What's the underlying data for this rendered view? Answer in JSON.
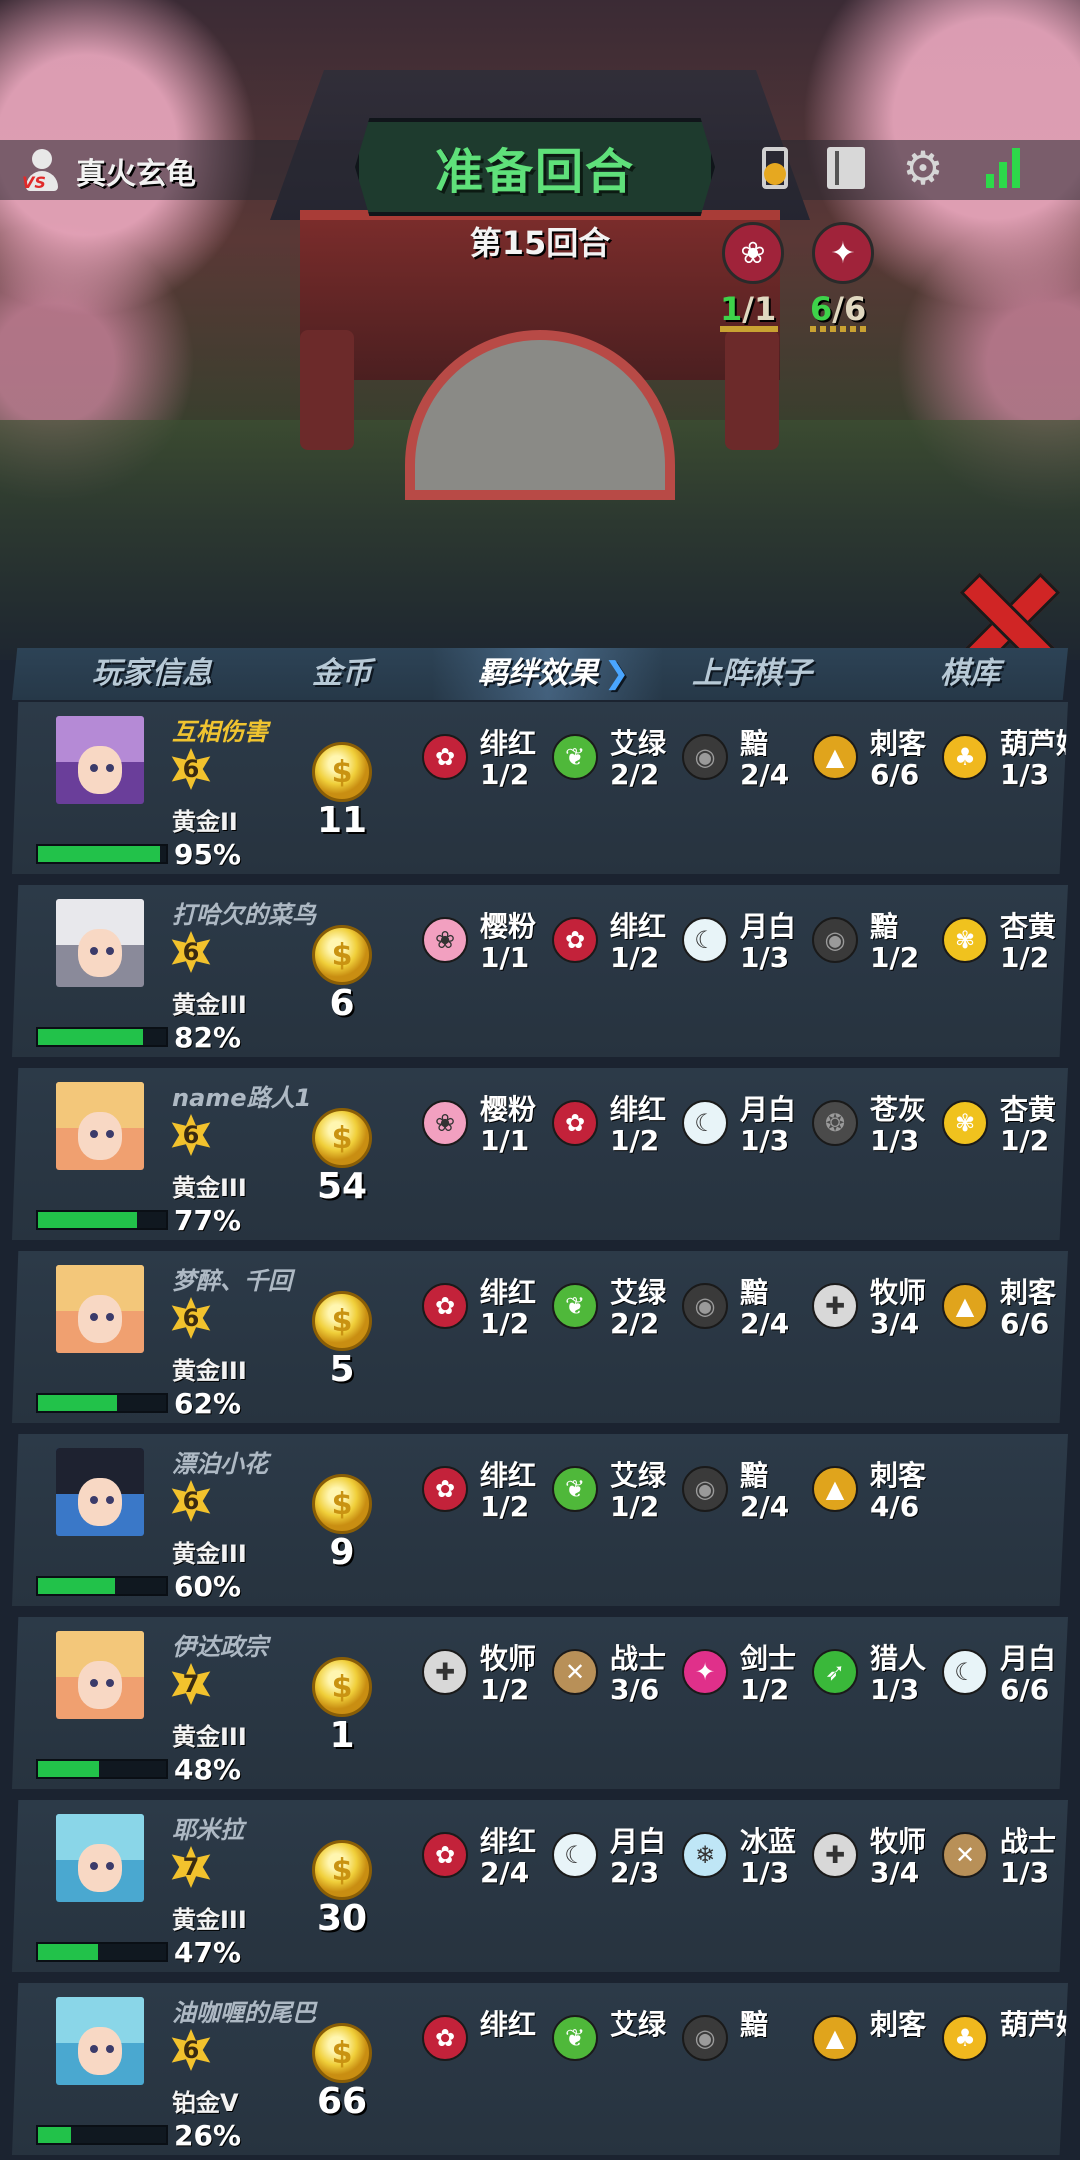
{
  "header": {
    "player_name": "真火玄龟",
    "phase": "准备回合",
    "round": "第15回合",
    "synergy_counts": [
      {
        "active": "1",
        "sep": "/",
        "total": "1",
        "color": "#a0233a",
        "icon": "sakura-icon"
      },
      {
        "active": "6",
        "sep": "/",
        "total": "6",
        "color": "#a0233a",
        "icon": "blade-icon"
      }
    ]
  },
  "tabs": {
    "player_info": "玩家信息",
    "gold": "金币",
    "bonds": "羁绊效果",
    "deployed": "上阵棋子",
    "library": "棋库"
  },
  "players": [
    {
      "name": "互相伤害",
      "level": "6",
      "rank": "黄金II",
      "hp": "95%",
      "hp_value": 0.95,
      "gold": "11",
      "is_self": true,
      "avatar_hair": "#b58ad6",
      "avatar_bg": "#6a3e9a",
      "bonds": [
        {
          "name": "绯红",
          "count": "1/2",
          "icon": "rose-icon",
          "bg": "#c3223a",
          "glyph": "✿"
        },
        {
          "name": "艾绿",
          "count": "2/2",
          "icon": "leaf-icon",
          "bg": "#4fb83a",
          "glyph": "❦"
        },
        {
          "name": "黯",
          "count": "2/4",
          "icon": "dark-eye-icon",
          "bg": "#3a3a3a",
          "glyph": "◉"
        },
        {
          "name": "刺客",
          "count": "6/6",
          "icon": "assassin-icon",
          "bg": "#e0a41c",
          "glyph": "▲"
        },
        {
          "name": "葫芦娃",
          "count": "1/3",
          "icon": "gourd-icon",
          "bg": "#f0b81e",
          "glyph": "♣"
        }
      ]
    },
    {
      "name": "打哈欠的菜鸟",
      "level": "6",
      "rank": "黄金III",
      "hp": "82%",
      "hp_value": 0.82,
      "gold": "6",
      "is_self": false,
      "avatar_hair": "#e8e8ec",
      "avatar_bg": "#8a8a9a",
      "bonds": [
        {
          "name": "樱粉",
          "count": "1/1",
          "icon": "sakura-icon",
          "bg": "#f2a0c0",
          "glyph": "❀"
        },
        {
          "name": "绯红",
          "count": "1/2",
          "icon": "rose-icon",
          "bg": "#c3223a",
          "glyph": "✿"
        },
        {
          "name": "月白",
          "count": "1/3",
          "icon": "moon-icon",
          "bg": "#e8f4f8",
          "glyph": "☾"
        },
        {
          "name": "黯",
          "count": "1/2",
          "icon": "dark-eye-icon",
          "bg": "#3a3a3a",
          "glyph": "◉"
        },
        {
          "name": "杏黄",
          "count": "1/2",
          "icon": "lotus-icon",
          "bg": "#f0c21e",
          "glyph": "✾"
        }
      ]
    },
    {
      "name": "name路人1",
      "level": "6",
      "rank": "黄金III",
      "hp": "77%",
      "hp_value": 0.77,
      "gold": "54",
      "is_self": false,
      "avatar_hair": "#f3c77a",
      "avatar_bg": "#f0a070",
      "bonds": [
        {
          "name": "樱粉",
          "count": "1/1",
          "icon": "sakura-icon",
          "bg": "#f2a0c0",
          "glyph": "❀"
        },
        {
          "name": "绯红",
          "count": "1/2",
          "icon": "rose-icon",
          "bg": "#c3223a",
          "glyph": "✿"
        },
        {
          "name": "月白",
          "count": "1/3",
          "icon": "moon-icon",
          "bg": "#e8f4f8",
          "glyph": "☾"
        },
        {
          "name": "苍灰",
          "count": "1/3",
          "icon": "grey-orb-icon",
          "bg": "#4a4a4a",
          "glyph": "❂"
        },
        {
          "name": "杏黄",
          "count": "1/2",
          "icon": "lotus-icon",
          "bg": "#f0c21e",
          "glyph": "✾"
        }
      ]
    },
    {
      "name": "梦醉、千回",
      "level": "6",
      "rank": "黄金III",
      "hp": "62%",
      "hp_value": 0.62,
      "gold": "5",
      "is_self": false,
      "avatar_hair": "#f3c77a",
      "avatar_bg": "#f0a070",
      "bonds": [
        {
          "name": "绯红",
          "count": "1/2",
          "icon": "rose-icon",
          "bg": "#c3223a",
          "glyph": "✿"
        },
        {
          "name": "艾绿",
          "count": "2/2",
          "icon": "leaf-icon",
          "bg": "#4fb83a",
          "glyph": "❦"
        },
        {
          "name": "黯",
          "count": "2/4",
          "icon": "dark-eye-icon",
          "bg": "#3a3a3a",
          "glyph": "◉"
        },
        {
          "name": "牧师",
          "count": "3/4",
          "icon": "priest-icon",
          "bg": "#d8d8d8",
          "glyph": "✚"
        },
        {
          "name": "刺客",
          "count": "6/6",
          "icon": "assassin-icon",
          "bg": "#e0a41c",
          "glyph": "▲"
        }
      ]
    },
    {
      "name": "漂泊小花",
      "level": "6",
      "rank": "黄金III",
      "hp": "60%",
      "hp_value": 0.6,
      "gold": "9",
      "is_self": false,
      "avatar_hair": "#1e2230",
      "avatar_bg": "#3a78c8",
      "bonds": [
        {
          "name": "绯红",
          "count": "1/2",
          "icon": "rose-icon",
          "bg": "#c3223a",
          "glyph": "✿"
        },
        {
          "name": "艾绿",
          "count": "1/2",
          "icon": "leaf-icon",
          "bg": "#4fb83a",
          "glyph": "❦"
        },
        {
          "name": "黯",
          "count": "2/4",
          "icon": "dark-eye-icon",
          "bg": "#3a3a3a",
          "glyph": "◉"
        },
        {
          "name": "刺客",
          "count": "4/6",
          "icon": "assassin-icon",
          "bg": "#e0a41c",
          "glyph": "▲"
        }
      ]
    },
    {
      "name": "伊达政宗",
      "level": "7",
      "rank": "黄金III",
      "hp": "48%",
      "hp_value": 0.48,
      "gold": "1",
      "is_self": false,
      "avatar_hair": "#f3c77a",
      "avatar_bg": "#f0a070",
      "bonds": [
        {
          "name": "牧师",
          "count": "1/2",
          "icon": "priest-icon",
          "bg": "#d8d8d8",
          "glyph": "✚"
        },
        {
          "name": "战士",
          "count": "3/6",
          "icon": "warrior-icon",
          "bg": "#b89058",
          "glyph": "✕"
        },
        {
          "name": "剑士",
          "count": "1/2",
          "icon": "swordsman-icon",
          "bg": "#e0308a",
          "glyph": "✦"
        },
        {
          "name": "猎人",
          "count": "1/3",
          "icon": "hunter-icon",
          "bg": "#3ab83a",
          "glyph": "➶"
        },
        {
          "name": "月白",
          "count": "6/6",
          "icon": "moon-icon",
          "bg": "#e8f4f8",
          "glyph": "☾"
        }
      ]
    },
    {
      "name": "耶米拉",
      "level": "7",
      "rank": "黄金III",
      "hp": "47%",
      "hp_value": 0.47,
      "gold": "30",
      "is_self": false,
      "avatar_hair": "#8ad6e8",
      "avatar_bg": "#4aa8d0",
      "bonds": [
        {
          "name": "绯红",
          "count": "2/4",
          "icon": "rose-icon",
          "bg": "#c3223a",
          "glyph": "✿"
        },
        {
          "name": "月白",
          "count": "2/3",
          "icon": "moon-icon",
          "bg": "#e8f4f8",
          "glyph": "☾"
        },
        {
          "name": "冰蓝",
          "count": "1/3",
          "icon": "snowflake-icon",
          "bg": "#bfe6f6",
          "glyph": "❄"
        },
        {
          "name": "牧师",
          "count": "3/4",
          "icon": "priest-icon",
          "bg": "#d8d8d8",
          "glyph": "✚"
        },
        {
          "name": "战士",
          "count": "1/3",
          "icon": "warrior-icon",
          "bg": "#b89058",
          "glyph": "✕"
        }
      ]
    },
    {
      "name": "油咖喱的尾巴",
      "level": "6",
      "rank": "铂金V",
      "hp": "26%",
      "hp_value": 0.26,
      "gold": "66",
      "is_self": false,
      "avatar_hair": "#8ad6e8",
      "avatar_bg": "#4aa8d0",
      "bonds": [
        {
          "name": "绯红",
          "count": "",
          "icon": "rose-icon",
          "bg": "#c3223a",
          "glyph": "✿"
        },
        {
          "name": "艾绿",
          "count": "",
          "icon": "leaf-icon",
          "bg": "#4fb83a",
          "glyph": "❦"
        },
        {
          "name": "黯",
          "count": "",
          "icon": "dark-eye-icon",
          "bg": "#3a3a3a",
          "glyph": "◉"
        },
        {
          "name": "刺客",
          "count": "",
          "icon": "assassin-icon",
          "bg": "#e0a41c",
          "glyph": "▲"
        },
        {
          "name": "葫芦娃",
          "count": "",
          "icon": "gourd-icon",
          "bg": "#f0b81e",
          "glyph": "♣"
        }
      ]
    }
  ]
}
